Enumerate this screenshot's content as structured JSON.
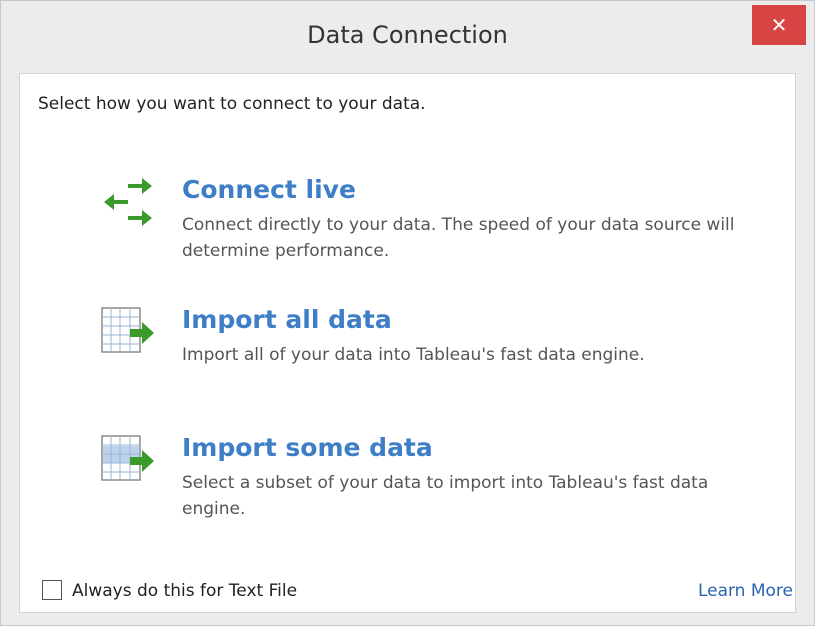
{
  "window": {
    "title": "Data Connection",
    "close_label": "✕"
  },
  "instructions": "Select how you want to connect to your data.",
  "options": [
    {
      "title": "Connect live",
      "description": "Connect directly to your data. The speed of your data source will determine performance.",
      "icon": "swap-arrows-icon"
    },
    {
      "title": "Import all data",
      "description": "Import all of your data into Tableau's fast data engine.",
      "icon": "table-import-icon"
    },
    {
      "title": "Import some data",
      "description": "Select a subset of your data to import into Tableau's fast data engine.",
      "icon": "table-import-partial-icon"
    }
  ],
  "footer": {
    "checkbox_label": "Always do this for Text File",
    "checkbox_checked": false,
    "learn_more": "Learn More"
  },
  "colors": {
    "accent": "#3d7ec6",
    "close": "#d64543",
    "arrow_green": "#3a9a2a"
  }
}
